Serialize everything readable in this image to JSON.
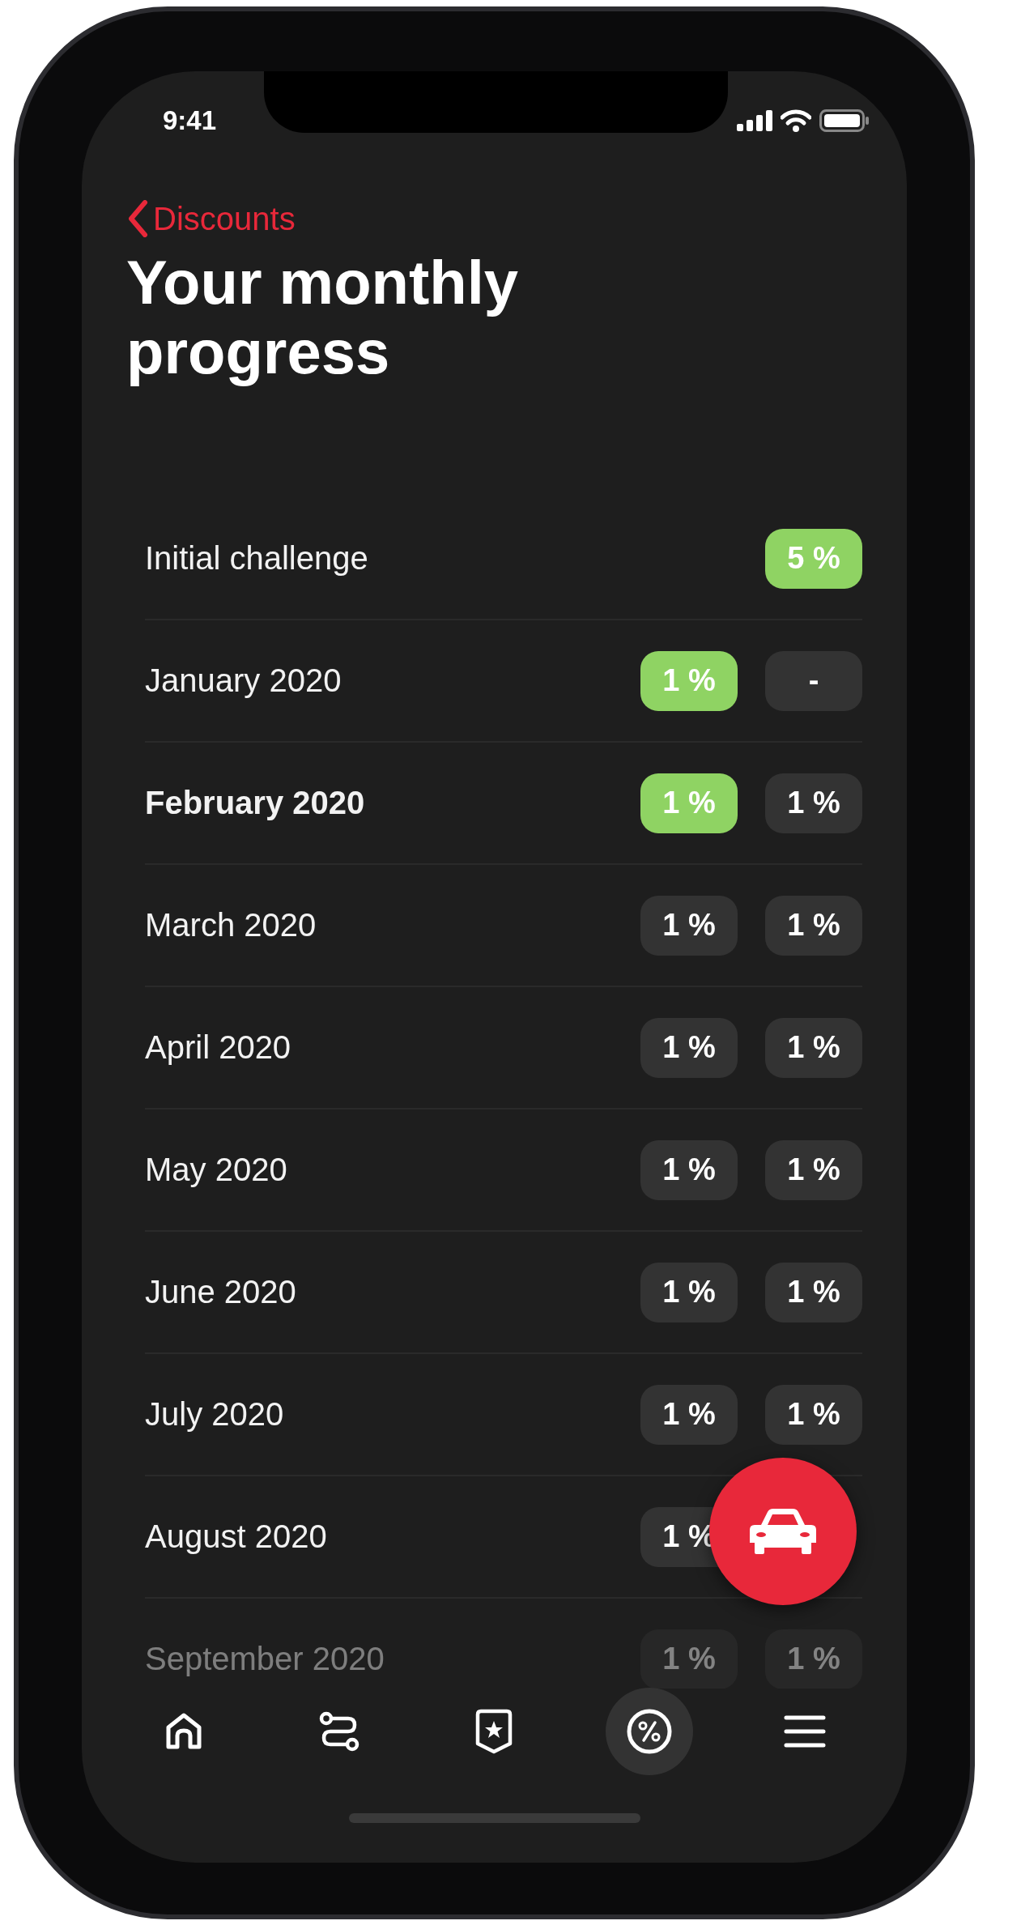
{
  "status_bar": {
    "time": "9:41"
  },
  "back_link": {
    "label": "Discounts"
  },
  "title": "Your monthly progress",
  "rows": [
    {
      "kind": "challenge",
      "label": "Initial challenge",
      "current": false,
      "faded": false,
      "badges": [
        {
          "text": "5 %",
          "achieved": true
        }
      ]
    },
    {
      "label": "January 2020",
      "current": false,
      "faded": false,
      "badges": [
        {
          "text": "1 %",
          "achieved": true
        },
        {
          "text": "-",
          "achieved": false
        }
      ]
    },
    {
      "label": "February 2020",
      "current": true,
      "faded": false,
      "badges": [
        {
          "text": "1 %",
          "achieved": true
        },
        {
          "text": "1 %",
          "achieved": false
        }
      ]
    },
    {
      "label": "March 2020",
      "current": false,
      "faded": false,
      "badges": [
        {
          "text": "1 %",
          "achieved": false
        },
        {
          "text": "1 %",
          "achieved": false
        }
      ]
    },
    {
      "label": "April 2020",
      "current": false,
      "faded": false,
      "badges": [
        {
          "text": "1 %",
          "achieved": false
        },
        {
          "text": "1 %",
          "achieved": false
        }
      ]
    },
    {
      "label": "May 2020",
      "current": false,
      "faded": false,
      "badges": [
        {
          "text": "1 %",
          "achieved": false
        },
        {
          "text": "1 %",
          "achieved": false
        }
      ]
    },
    {
      "label": "June 2020",
      "current": false,
      "faded": false,
      "badges": [
        {
          "text": "1 %",
          "achieved": false
        },
        {
          "text": "1 %",
          "achieved": false
        }
      ]
    },
    {
      "label": "July 2020",
      "current": false,
      "faded": false,
      "badges": [
        {
          "text": "1 %",
          "achieved": false
        },
        {
          "text": "1 %",
          "achieved": false
        }
      ]
    },
    {
      "label": "August 2020",
      "current": false,
      "faded": false,
      "badges": [
        {
          "text": "1 %",
          "achieved": false
        }
      ]
    },
    {
      "label": "September 2020",
      "current": false,
      "faded": true,
      "badges": [
        {
          "text": "1 %",
          "achieved": false
        },
        {
          "text": "1 %",
          "achieved": false
        }
      ]
    }
  ],
  "nav": [
    {
      "kind": "home",
      "selected": false
    },
    {
      "kind": "route",
      "selected": false
    },
    {
      "kind": "badge",
      "selected": false
    },
    {
      "kind": "discount",
      "selected": true
    },
    {
      "kind": "menu",
      "selected": false
    }
  ]
}
